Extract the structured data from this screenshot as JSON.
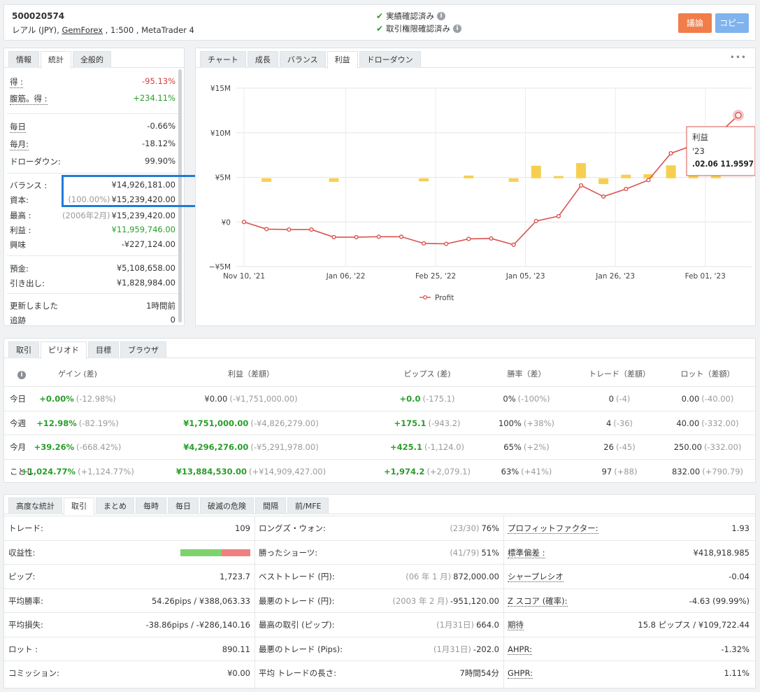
{
  "header": {
    "account_id": "500020574",
    "sub_prefix": "レアル (JPY), ",
    "broker": "GemForex",
    "sub_suffix": " , 1:500 , MetaTrader 4",
    "verify1": "実績確認済み",
    "verify2": "取引権限確認済み",
    "discuss_label": "議論",
    "copy_label": "コピー",
    "colors": {
      "discuss": "#f07d4a",
      "copy": "#7fb3ee"
    }
  },
  "stats": {
    "tabs": [
      "情報",
      "統計",
      "全般的"
    ],
    "active_tab": 1,
    "rows": [
      {
        "k": "得 :",
        "v": "-95.13%",
        "cls": "neg",
        "dotted": true
      },
      {
        "k": "腹筋。得 :",
        "v": "+234.11%",
        "cls": "pos",
        "dotted": true
      },
      {
        "k": "毎日",
        "v": "-0.66%",
        "cls": "",
        "dotted": true
      },
      {
        "k": "毎月:",
        "v": "-18.12%",
        "cls": "",
        "dotted": true
      },
      {
        "k": "ドローダウン:",
        "v": "99.90%",
        "cls": "",
        "dotted": false
      },
      {
        "k": "バランス :",
        "v": "¥14,926,181.00",
        "cls": "",
        "dotted": false,
        "pre": ""
      },
      {
        "k": "資本:",
        "v": "¥15,239,420.00",
        "cls": "",
        "dotted": false,
        "pre": "(100.00%)"
      },
      {
        "k": "最高 :",
        "v": "¥15,239,420.00",
        "cls": "",
        "dotted": false,
        "pre": "(2006年2月)"
      },
      {
        "k": "利益 :",
        "v": "¥11,959,746.00",
        "cls": "pos",
        "dotted": false
      },
      {
        "k": "興味",
        "v": "-¥227,124.00",
        "cls": "",
        "dotted": false
      },
      {
        "k": "預金:",
        "v": "¥5,108,658.00",
        "cls": "",
        "dotted": false
      },
      {
        "k": "引き出し:",
        "v": "¥1,828,984.00",
        "cls": "",
        "dotted": false
      },
      {
        "k": "更新しました",
        "v": "1時間前",
        "cls": "",
        "dotted": false
      },
      {
        "k": "追跡",
        "v": "0",
        "cls": "",
        "dotted": false
      }
    ]
  },
  "chart_tabs": [
    "チャート",
    "成長",
    "バランス",
    "利益",
    "ドローダウン"
  ],
  "chart_active": 3,
  "chart_menu": "•••",
  "tooltip": {
    "title": "利益",
    "line1": "'23",
    "line2": ".02.06 11.9597"
  },
  "chart_data": {
    "type": "line",
    "title": "",
    "ylabel": "",
    "xlabel": "",
    "ylim": [
      -5000000,
      15000000
    ],
    "y_ticks": [
      "¥15M",
      "¥10M",
      "¥5M",
      "¥0",
      "−¥5M"
    ],
    "y_tick_values": [
      15000000,
      10000000,
      5000000,
      0,
      -5000000
    ],
    "x_tick_labels": [
      "Nov 10, '21",
      "Jan 06, '22",
      "Feb 25, '22",
      "Jan 05, '23",
      "Jan 26, '23",
      "Feb 01, '23"
    ],
    "x_tick_index": [
      0,
      4,
      8,
      12,
      16,
      20
    ],
    "legend": "Profit",
    "legend_position": "bottom",
    "series": [
      {
        "name": "Profit",
        "type": "line",
        "color": "#d9534f",
        "values": [
          0,
          -800000,
          -850000,
          -850000,
          -1700000,
          -1700000,
          -1650000,
          -1650000,
          -2400000,
          -2450000,
          -1900000,
          -1850000,
          -2550000,
          100000,
          650000,
          4100000,
          2850000,
          3700000,
          4700000,
          7700000,
          8600000,
          9600000,
          11960000
        ]
      },
      {
        "name": "",
        "type": "bar",
        "color": "#f7cf50",
        "values": [
          null,
          -400000,
          null,
          null,
          -400000,
          null,
          null,
          null,
          -350000,
          null,
          300000,
          null,
          -400000,
          1400000,
          250000,
          1700000,
          -650000,
          400000,
          450000,
          1450000,
          450000,
          300000,
          null
        ]
      }
    ]
  },
  "period": {
    "tabs": [
      "取引",
      "ピリオド",
      "目標",
      "ブラウザ"
    ],
    "active_tab": 1,
    "headers": [
      "ゲイン (差)",
      "利益（差額）",
      "ピップス (差)",
      "勝率（差）",
      "トレード（差額）",
      "ロット（差額）"
    ],
    "rows": [
      {
        "label": "今日",
        "gain": "+0.00%",
        "gain_d": "(-12.98%)",
        "profit": "¥0.00",
        "profit_d": "(-¥1,751,000.00)",
        "profit_pos": false,
        "pips": "+0.0",
        "pips_d": "(-175.1)",
        "win": "0%",
        "win_d": "(-100%)",
        "trades": "0",
        "trades_d": "(-4)",
        "lots": "0.00",
        "lots_d": "(-40.00)"
      },
      {
        "label": "今週",
        "gain": "+12.98%",
        "gain_d": "(-82.19%)",
        "profit": "¥1,751,000.00",
        "profit_d": "(-¥4,826,279.00)",
        "profit_pos": true,
        "pips": "+175.1",
        "pips_d": "(-943.2)",
        "win": "100%",
        "win_d": "(+38%)",
        "trades": "4",
        "trades_d": "(-36)",
        "lots": "40.00",
        "lots_d": "(-332.00)"
      },
      {
        "label": "今月",
        "gain": "+39.26%",
        "gain_d": "(-668.42%)",
        "profit": "¥4,296,276.00",
        "profit_d": "(-¥5,291,978.00)",
        "profit_pos": true,
        "pips": "+425.1",
        "pips_d": "(-1,124.0)",
        "win": "65%",
        "win_d": "(+2%)",
        "trades": "26",
        "trades_d": "(-45)",
        "lots": "250.00",
        "lots_d": "(-332.00)"
      },
      {
        "label": "ことし",
        "gain": "+1,024.77%",
        "gain_d": "(+1,124.77%)",
        "profit": "¥13,884,530.00",
        "profit_d": "(+¥14,909,427.00)",
        "profit_pos": true,
        "pips": "+1,974.2",
        "pips_d": "(+2,079.1)",
        "win": "63%",
        "win_d": "(+41%)",
        "trades": "97",
        "trades_d": "(+88)",
        "lots": "832.00",
        "lots_d": "(+790.79)"
      }
    ]
  },
  "adv": {
    "tabs": [
      "高度な統計",
      "取引",
      "まとめ",
      "毎時",
      "毎日",
      "破滅の危険",
      "間隔",
      "前/MFE"
    ],
    "active_tab": 1,
    "profitability": {
      "win_fraction": 0.59,
      "win_color": "#7ed36d",
      "loss_color": "#f08080"
    },
    "rows": [
      {
        "c1k": "トレード:",
        "c1v": "109",
        "c2k": "ロングズ・ウォン:",
        "c2m": "(23/30)",
        "c2v": "76%",
        "c3k": "プロフィットファクター:",
        "c3v": "1.93"
      },
      {
        "c1k": "収益性:",
        "c1v": "",
        "c2k": "勝ったショーツ:",
        "c2m": "(41/79)",
        "c2v": "51%",
        "c3k": "標準偏差 :",
        "c3v": "¥418,918.985"
      },
      {
        "c1k": "ピップ:",
        "c1v": "1,723.7",
        "c2k": "ベストトレード (円):",
        "c2m": "(06 年 1 月)",
        "c2v": "872,000.00",
        "c3k": "シャープレシオ",
        "c3v": "-0.04"
      },
      {
        "c1k": "平均勝率:",
        "c1v": "54.26pips / ¥388,063.33",
        "c2k": "最悪のトレード (円):",
        "c2m": "(2003 年 2 月)",
        "c2v": "-951,120.00",
        "c3k": "Z スコア (確率):",
        "c3v": "-4.63 (99.99%)"
      },
      {
        "c1k": "平均損失:",
        "c1v": "-38.86pips / -¥286,140.16",
        "c2k": "最高の取引 (ピップ):",
        "c2m": "(1月31日)",
        "c2v": "664.0",
        "c3k": "期待",
        "c3v": "15.8 ピップス / ¥109,722.44"
      },
      {
        "c1k": "ロット :",
        "c1v": "890.11",
        "c2k": "最悪のトレード (Pips):",
        "c2m": "(1月31日)",
        "c2v": "-202.0",
        "c3k": "AHPR:",
        "c3v": "-1.32%"
      },
      {
        "c1k": "コミッション:",
        "c1v": "¥0.00",
        "c2k": "平均 トレードの長さ:",
        "c2m": "",
        "c2v": "7時間54分",
        "c3k": "GHPR:",
        "c3v": "1.11%"
      }
    ]
  }
}
